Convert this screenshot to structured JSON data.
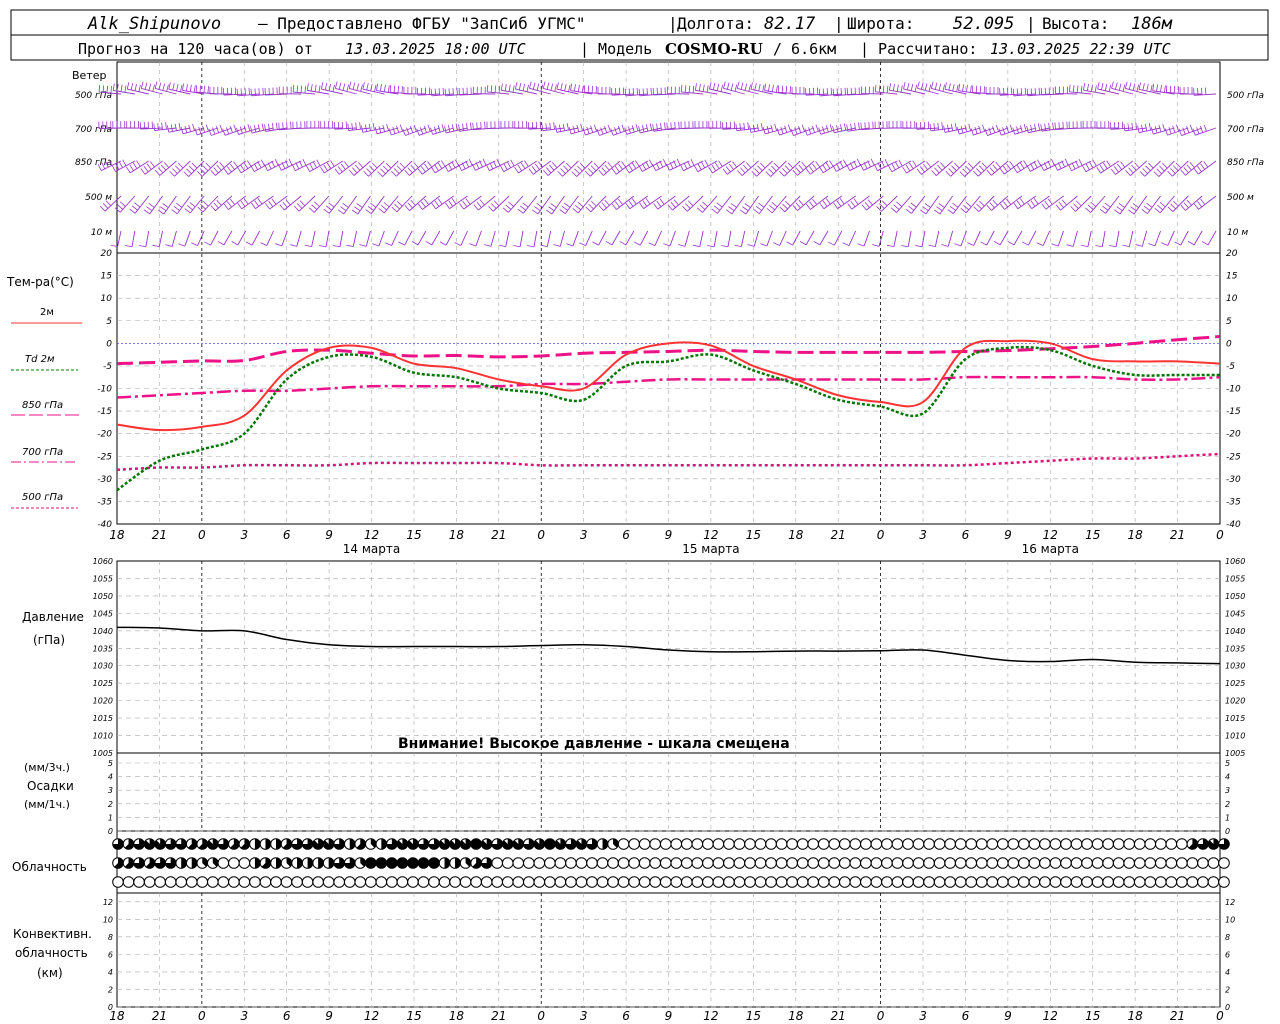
{
  "header": {
    "station": "Alk_Shipunovo",
    "provider": "– Предоставлено ФГБУ \"ЗапСиб УГМС\"",
    "lon_label": "Долгота:",
    "lon": "82.17",
    "lat_label": "Широта:",
    "lat": "52.095",
    "alt_label": "Высота:",
    "alt": "186м",
    "forecast_prefix": "Прогноз на 120 часа(ов) от",
    "forecast_start": "13.03.2025 18:00 UTC",
    "model_label": "| Модель",
    "model": "COSMO-RU",
    "resolution": "/ 6.6км",
    "computed_label": "| Рассчитано:",
    "computed": "13.03.2025 22:39 UTC"
  },
  "labels": {
    "wind": "Ветер",
    "wind_levels": [
      "500 гПа",
      "700 гПа",
      "850 гПа",
      "500 м",
      "10 м"
    ],
    "temp_title": "Тем-ра(°C)",
    "legend_2m": "2м",
    "legend_td": "Td 2м",
    "legend_850": "850 гПа",
    "legend_700": "700 гПа",
    "legend_500": "500 гПа",
    "pressure_title": "Давление",
    "pressure_unit": "(гПа)",
    "pressure_warning": "Внимание! Высокое давление - шкала смещена",
    "precip_unit3": "(мм/3ч.)",
    "precip_title": "Осадки",
    "precip_unit1": "(мм/1ч.)",
    "cloud_title": "Облачность",
    "conv_title1": "Конвективн.",
    "conv_title2": "облачность",
    "conv_title3": "(км)"
  },
  "colors": {
    "wind": "#9933cc",
    "t2m": "#ff3333",
    "td2m": "#007700",
    "t850": "#ee1188",
    "t700": "#ee1188",
    "t500": "#dd1177",
    "zero_line": "#3333ff"
  },
  "chart_data": {
    "type": "line",
    "x_hours_utc": [
      18,
      21,
      0,
      3,
      6,
      9,
      12,
      15,
      18,
      21,
      0,
      3,
      6,
      9,
      12,
      15,
      18,
      21,
      0,
      3,
      6,
      9,
      12,
      15,
      18,
      21,
      0
    ],
    "x_tick_labels": [
      "18",
      "21",
      "0",
      "3",
      "6",
      "9",
      "12",
      "15",
      "18",
      "21",
      "0",
      "3",
      "6",
      "9",
      "12",
      "15",
      "18",
      "21",
      "0",
      "3",
      "6",
      "9",
      "12",
      "15",
      "18",
      "21",
      "0"
    ],
    "day_labels": [
      {
        "label": "14 марта",
        "at_tick": 6
      },
      {
        "label": "15 марта",
        "at_tick": 14
      },
      {
        "label": "16 марта",
        "at_tick": 22
      }
    ],
    "temperature": {
      "ylim": [
        -40,
        20
      ],
      "yticks": [
        20,
        15,
        10,
        5,
        0,
        -5,
        -10,
        -15,
        -20,
        -25,
        -30,
        -35,
        -40
      ],
      "series": [
        {
          "name": "2м",
          "key": "t2m",
          "values": [
            -18,
            -19.2,
            -18.5,
            -16,
            -6,
            -1,
            -1,
            -4.5,
            -5.5,
            -8,
            -9.5,
            -10,
            -2.5,
            0,
            -0.5,
            -5,
            -8,
            -11.5,
            -13,
            -13,
            -1,
            0.5,
            0,
            -3.5,
            -4,
            -4,
            -4.5
          ]
        },
        {
          "name": "Td 2м",
          "key": "td2m",
          "values": [
            -32.5,
            -26,
            -23.5,
            -20,
            -8,
            -3,
            -3,
            -6.5,
            -7.5,
            -10,
            -11,
            -12.5,
            -5,
            -4,
            -2.5,
            -6,
            -9,
            -12.5,
            -14,
            -15.5,
            -3.5,
            -1,
            -1.5,
            -5,
            -7,
            -7,
            -7
          ]
        },
        {
          "name": "850 гПа",
          "key": "t850",
          "values": [
            -4.5,
            -4.2,
            -3.9,
            -3.8,
            -1.8,
            -1.5,
            -2.2,
            -2.8,
            -2.7,
            -3,
            -2.8,
            -2.2,
            -2,
            -1.8,
            -1.5,
            -1.8,
            -2,
            -2,
            -2,
            -2,
            -1.8,
            -1.6,
            -1.2,
            -0.7,
            0,
            0.8,
            1.5
          ]
        },
        {
          "name": "700 гПа",
          "key": "t700",
          "values": [
            -12,
            -11.5,
            -11,
            -10.5,
            -10.5,
            -10,
            -9.5,
            -9.5,
            -9.5,
            -9.5,
            -9,
            -9,
            -8.5,
            -8,
            -8,
            -8,
            -8,
            -8,
            -8,
            -8,
            -7.5,
            -7.5,
            -7.5,
            -7.5,
            -8,
            -8,
            -7.5
          ]
        },
        {
          "name": "500 гПа",
          "key": "t500",
          "values": [
            -28,
            -27.5,
            -27.5,
            -27,
            -27,
            -27,
            -26.5,
            -26.5,
            -26.5,
            -26.5,
            -27,
            -27,
            -27,
            -27,
            -27,
            -27,
            -27,
            -27,
            -27,
            -27,
            -27,
            -26.5,
            -26,
            -25.5,
            -25.5,
            -25,
            -24.5
          ]
        }
      ]
    },
    "pressure": {
      "ylim": [
        1005,
        1060
      ],
      "yticks": [
        1060,
        1055,
        1050,
        1045,
        1040,
        1035,
        1030,
        1025,
        1020,
        1015,
        1010,
        1005
      ],
      "values": [
        1041,
        1040.8,
        1040,
        1040,
        1037.5,
        1036,
        1035.5,
        1035.5,
        1035.5,
        1035.5,
        1035.8,
        1036,
        1035.5,
        1034.5,
        1034,
        1034,
        1034.2,
        1034.2,
        1034.3,
        1034.5,
        1033,
        1031.5,
        1031.2,
        1031.8,
        1031,
        1030.8,
        1030.6
      ]
    },
    "precip": {
      "ylim": [
        0,
        5
      ],
      "yticks": [
        5,
        4,
        3,
        2,
        1,
        0
      ],
      "values": []
    },
    "convective_cloud": {
      "ylim": [
        0,
        13
      ],
      "yticks": [
        12,
        10,
        8,
        6,
        4,
        2,
        0
      ],
      "values": []
    },
    "cloud_cover_octas": {
      "row1": [
        6,
        5,
        6,
        7,
        7,
        6,
        6,
        5,
        5,
        7,
        6,
        5,
        5,
        4,
        4,
        4,
        5,
        6,
        6,
        7,
        7,
        6,
        4,
        5,
        3,
        4,
        6,
        7,
        7,
        6,
        6,
        7,
        7,
        7,
        8,
        7,
        6,
        7,
        7,
        6,
        7,
        8,
        7,
        6,
        7,
        6,
        4,
        3,
        0,
        0,
        0,
        0,
        0,
        0,
        0,
        0,
        0,
        0,
        0,
        0,
        0,
        0,
        0,
        0,
        0,
        0,
        0,
        0,
        0,
        0,
        0,
        0,
        0,
        0,
        0,
        0,
        0,
        0,
        0,
        0,
        0,
        0,
        0,
        0,
        0,
        0,
        0,
        0,
        0,
        0,
        0,
        0,
        0,
        0,
        0,
        0,
        0,
        0,
        0,
        0,
        0,
        0,
        5,
        6,
        7,
        6
      ],
      "row2": [
        5,
        5,
        6,
        5,
        6,
        6,
        4,
        4,
        3,
        3,
        0,
        0,
        0,
        4,
        5,
        4,
        3,
        4,
        4,
        4,
        4,
        6,
        6,
        3,
        8,
        8,
        8,
        8,
        8,
        8,
        8,
        4,
        4,
        3,
        5,
        6,
        0,
        0,
        0,
        0,
        0,
        0,
        0,
        0,
        0,
        0,
        0,
        0,
        0,
        0,
        0,
        0,
        0,
        0,
        0,
        0,
        0,
        0,
        0,
        0,
        0,
        0,
        0,
        0,
        0,
        0,
        0,
        0,
        0,
        0,
        0,
        0,
        0,
        0,
        0,
        0,
        0,
        0,
        0,
        0,
        0,
        0,
        0,
        0,
        0,
        0,
        0,
        0,
        0,
        0,
        0,
        0,
        0,
        0,
        0,
        0,
        0,
        0,
        0,
        0,
        0,
        0,
        0,
        0,
        0,
        0
      ],
      "row3": []
    },
    "wind_barbs": [
      {
        "level": "500 гПа",
        "dir_deg": 275,
        "speed_kt": 60
      },
      {
        "level": "700 гПа",
        "dir_deg": 260,
        "speed_kt": 40
      },
      {
        "level": "850 гПа",
        "dir_deg": 235,
        "speed_kt": 35
      },
      {
        "level": "500 м",
        "dir_deg": 225,
        "speed_kt": 30
      },
      {
        "level": "10 м",
        "dir_deg": 200,
        "speed_kt": 10
      }
    ]
  }
}
